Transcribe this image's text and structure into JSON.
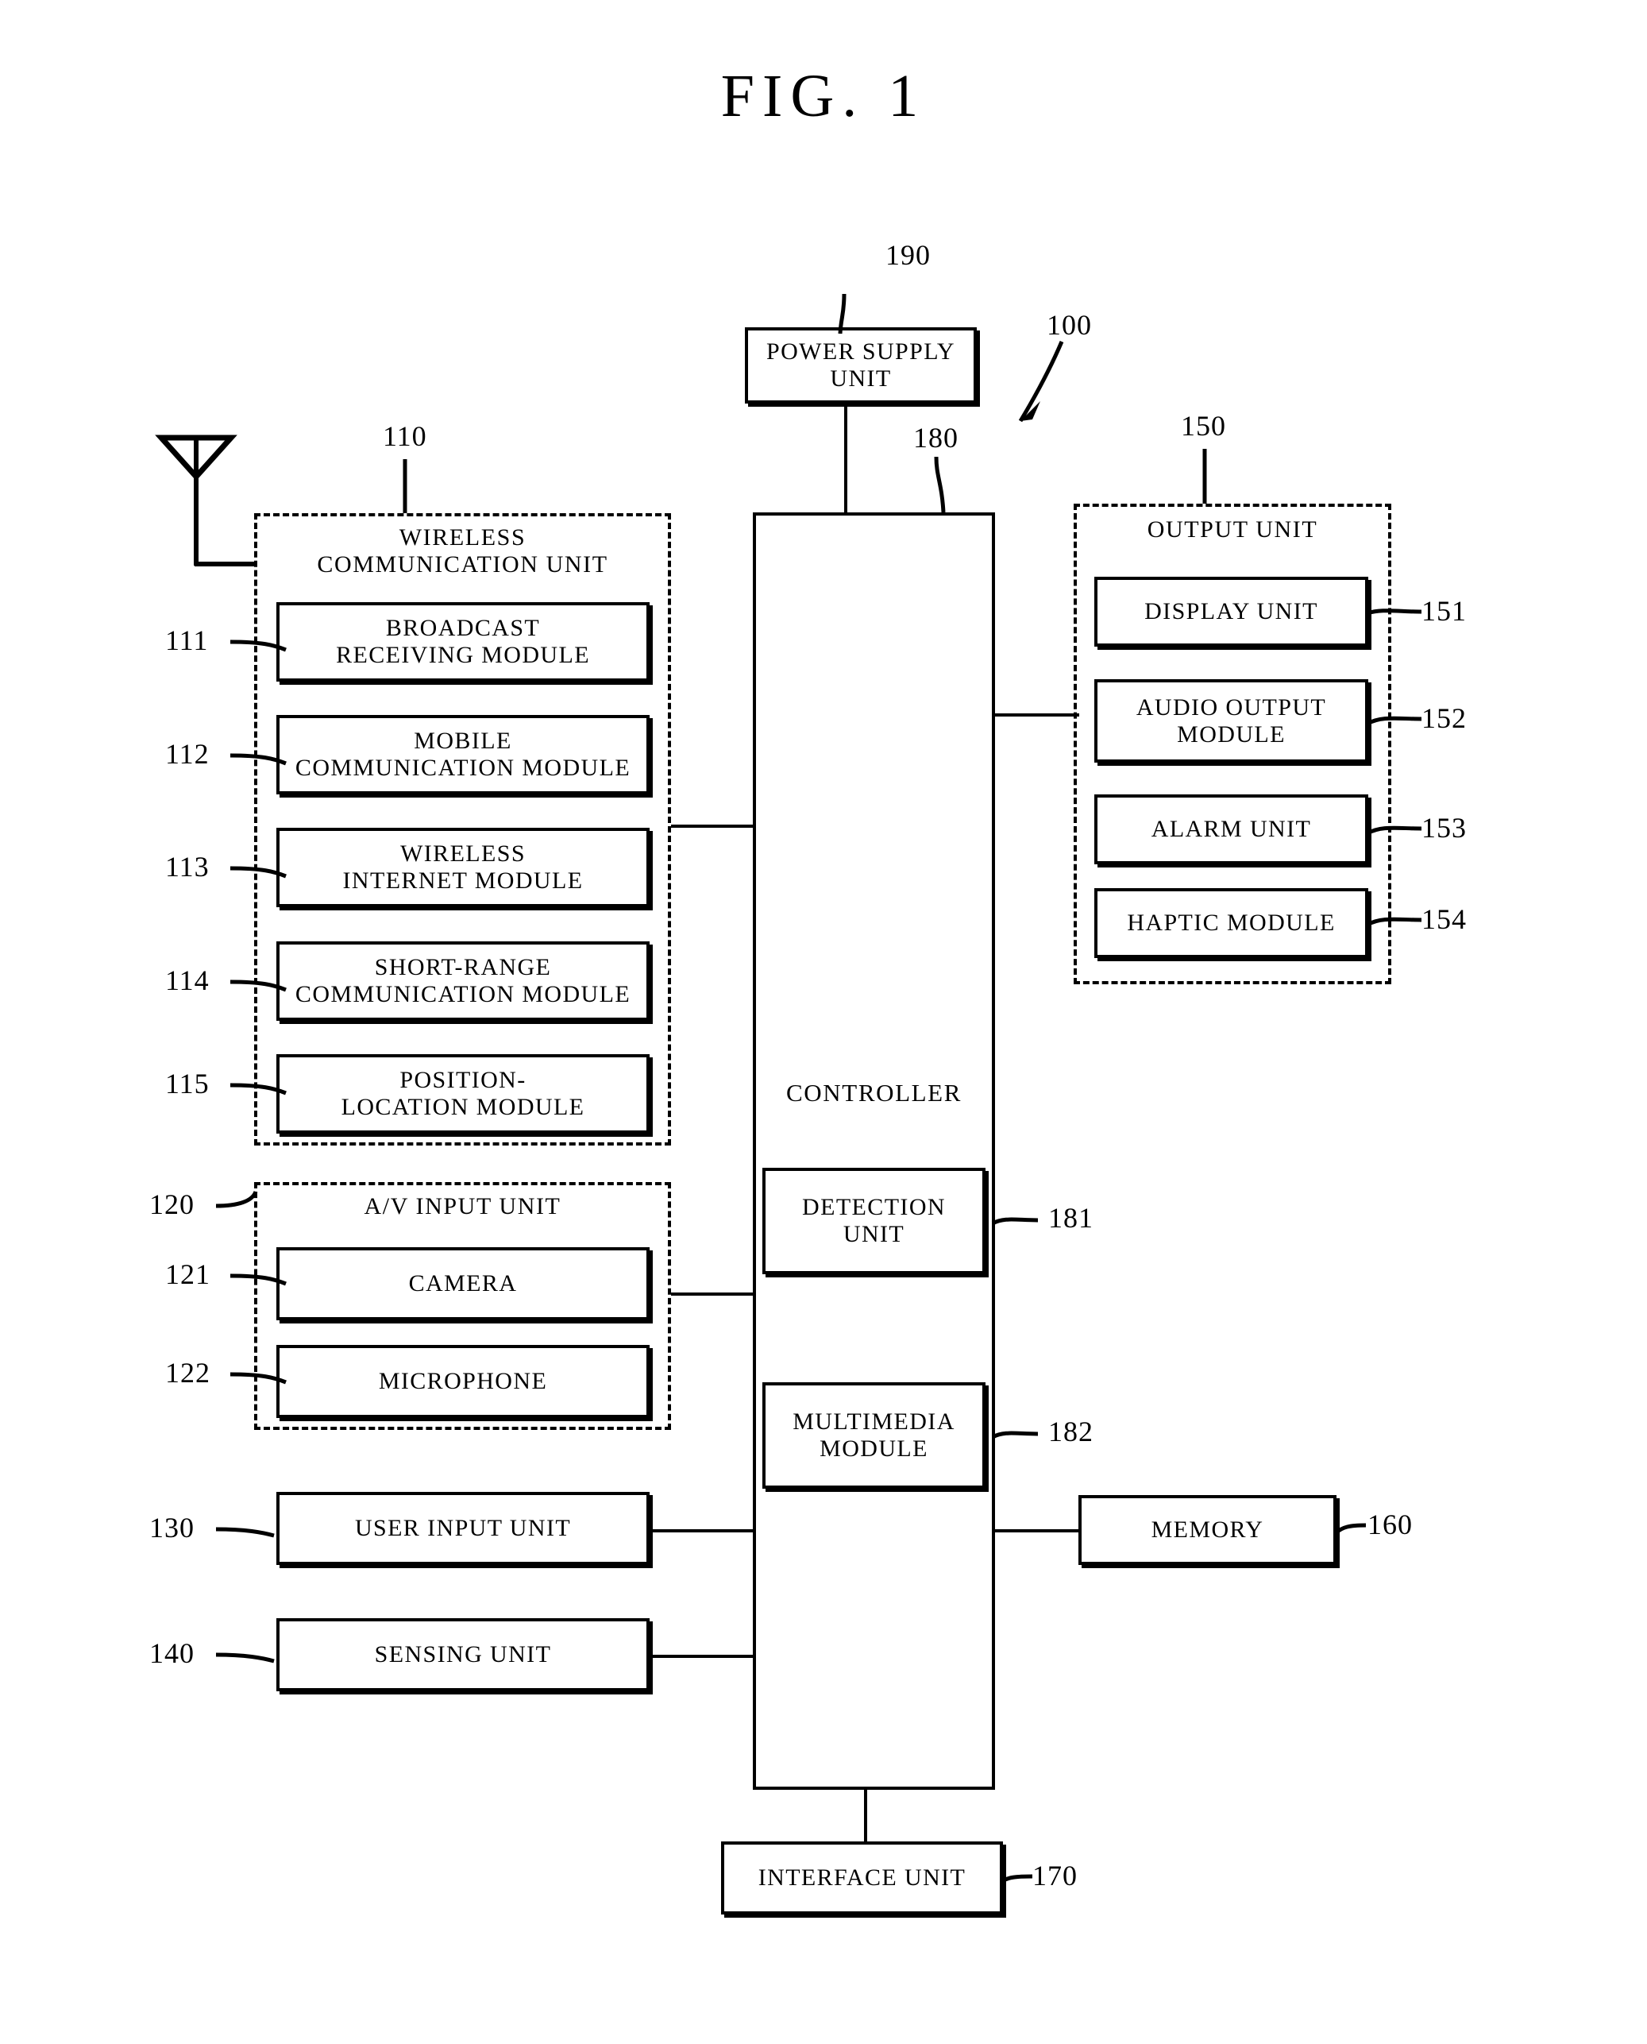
{
  "figure": {
    "title": "FIG. 1",
    "device_ref": "100"
  },
  "power_supply": {
    "label": "POWER SUPPLY\nUNIT",
    "line1": "POWER SUPPLY",
    "line2": "UNIT",
    "ref": "190"
  },
  "controller": {
    "label": "CONTROLLER",
    "ref": "180",
    "submodules": [
      {
        "line1": "DETECTION",
        "line2": "UNIT",
        "ref": "181"
      },
      {
        "line1": "MULTIMEDIA",
        "line2": "MODULE",
        "ref": "182"
      }
    ]
  },
  "wireless_communication_unit": {
    "title_line1": "WIRELESS",
    "title_line2": "COMMUNICATION UNIT",
    "ref": "110",
    "modules": [
      {
        "line1": "BROADCAST",
        "line2": "RECEIVING MODULE",
        "ref": "111"
      },
      {
        "line1": "MOBILE",
        "line2": "COMMUNICATION MODULE",
        "ref": "112"
      },
      {
        "line1": "WIRELESS",
        "line2": "INTERNET MODULE",
        "ref": "113"
      },
      {
        "line1": "SHORT-RANGE",
        "line2": "COMMUNICATION MODULE",
        "ref": "114"
      },
      {
        "line1": "POSITION-",
        "line2": "LOCATION MODULE",
        "ref": "115"
      }
    ]
  },
  "av_input_unit": {
    "title": "A/V INPUT UNIT",
    "ref": "120",
    "modules": [
      {
        "line1": "CAMERA",
        "line2": "",
        "ref": "121"
      },
      {
        "line1": "MICROPHONE",
        "line2": "",
        "ref": "122"
      }
    ]
  },
  "user_input_unit": {
    "label": "USER INPUT UNIT",
    "ref": "130"
  },
  "sensing_unit": {
    "label": "SENSING UNIT",
    "ref": "140"
  },
  "output_unit": {
    "title": "OUTPUT UNIT",
    "ref": "150",
    "modules": [
      {
        "line1": "DISPLAY UNIT",
        "line2": "",
        "ref": "151"
      },
      {
        "line1": "AUDIO OUTPUT",
        "line2": "MODULE",
        "ref": "152"
      },
      {
        "line1": "ALARM UNIT",
        "line2": "",
        "ref": "153"
      },
      {
        "line1": "HAPTIC MODULE",
        "line2": "",
        "ref": "154"
      }
    ]
  },
  "memory": {
    "label": "MEMORY",
    "ref": "160"
  },
  "interface_unit": {
    "label": "INTERFACE UNIT",
    "ref": "170"
  },
  "antenna": {
    "name": "antenna-symbol"
  },
  "colors": {
    "ink": "#000000",
    "paper": "#ffffff"
  }
}
